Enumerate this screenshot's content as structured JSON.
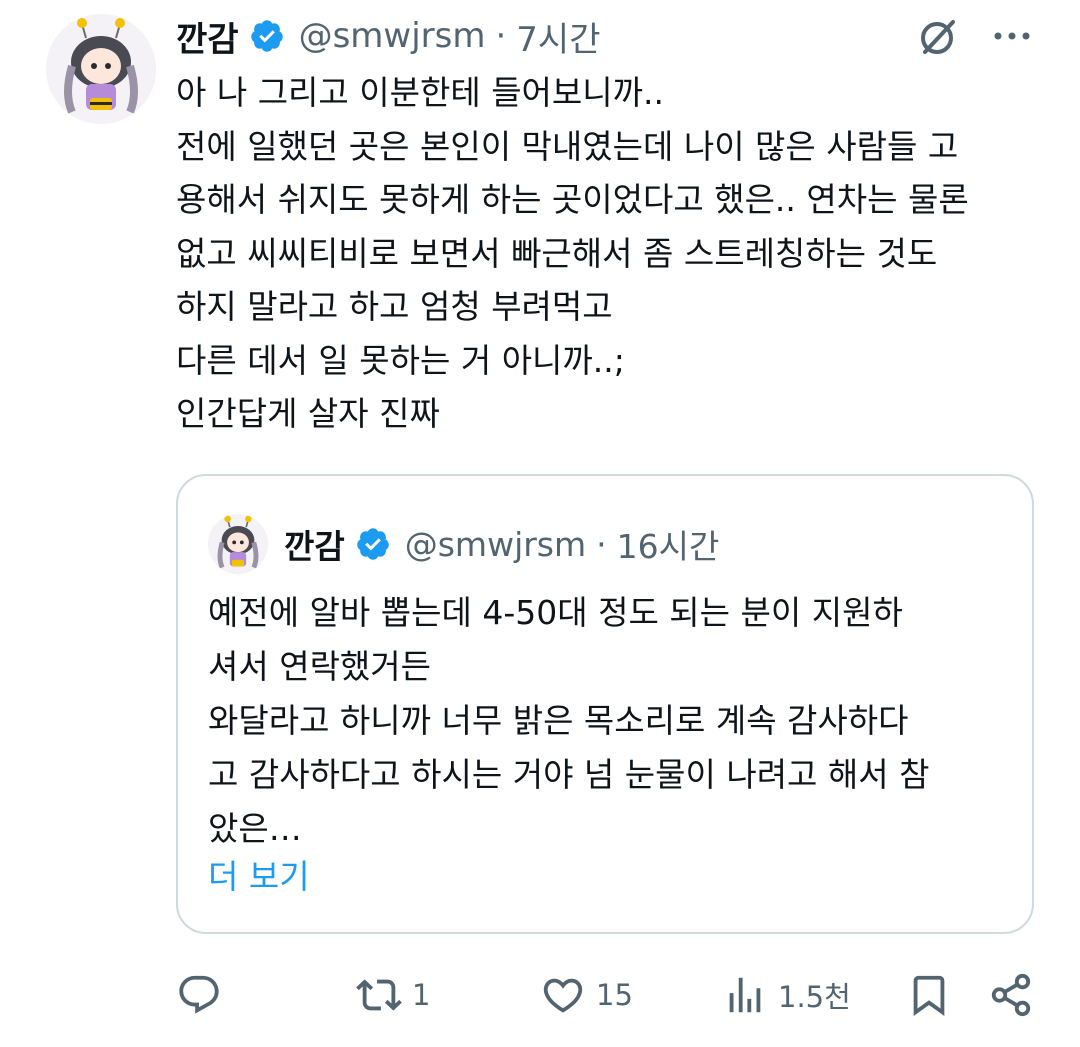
{
  "tweet": {
    "display_name": "깐감",
    "handle": "@smwjrsm",
    "separator": "·",
    "time": "7시간",
    "lines": [
      "아 나 그리고 이분한테 들어보니까..",
      "전에 일했던 곳은 본인이 막내였는데 나이 많은 사람들 고",
      "용해서 쉬지도 못하게 하는 곳이었다고 했은.. 연차는 물론",
      "없고 씨씨티비로 보면서 빠근해서 좀 스트레칭하는 것도",
      "하지 말라고 하고 엄청 부려먹고",
      "다른 데서 일 못하는 거 아니까..;",
      "인간답게 살자 진짜"
    ]
  },
  "quote": {
    "display_name": "깐감",
    "handle": "@smwjrsm",
    "separator": "·",
    "time": "16시간",
    "lines": [
      "예전에 알바 뽑는데 4-50대 정도 되는 분이 지원하",
      "셔서 연락했거든",
      "와달라고 하니까 너무 밝은 목소리로 계속 감사하다",
      "고 감사하다고 하시는 거야 넘 눈물이 나려고 해서 참",
      "았은…"
    ],
    "show_more": "더 보기"
  },
  "actions": {
    "reply": {
      "icon": "reply-icon",
      "count": ""
    },
    "retweet": {
      "icon": "retweet-icon",
      "count": "1"
    },
    "like": {
      "icon": "heart-icon",
      "count": "15"
    },
    "views": {
      "icon": "views-icon",
      "count": "1.5천"
    },
    "bookmark": {
      "icon": "bookmark-icon"
    },
    "share": {
      "icon": "share-icon"
    }
  },
  "colors": {
    "verified": "#1d9bf0",
    "link": "#1d9bf0",
    "muted": "#536471",
    "text": "#0f1419",
    "border": "#cfd9de"
  }
}
